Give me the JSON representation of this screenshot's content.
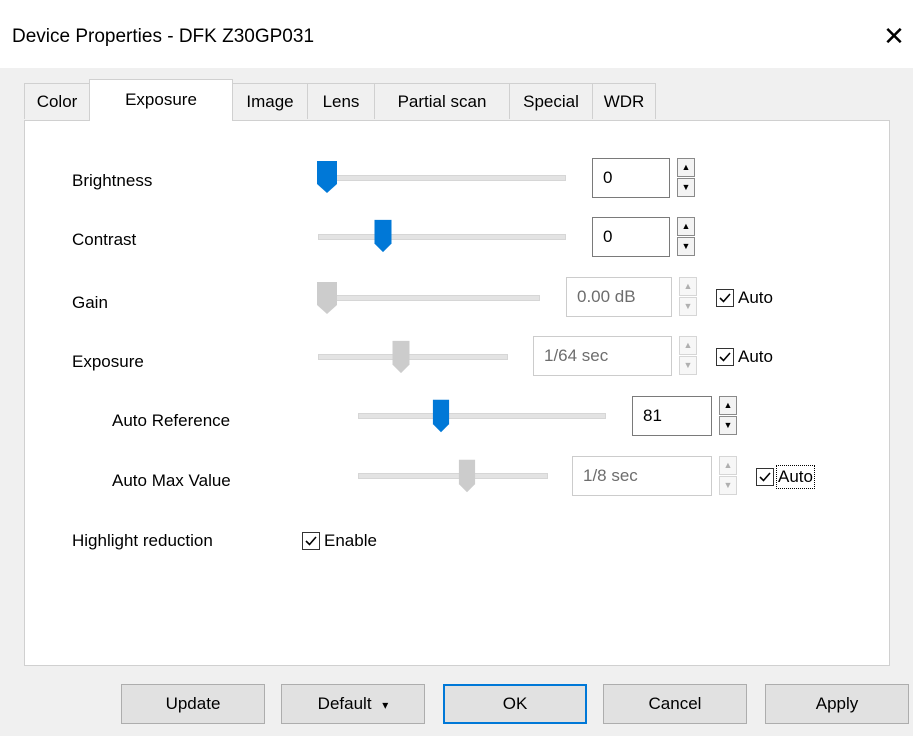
{
  "window": {
    "title": "Device Properties - DFK Z30GP031",
    "close_icon": "close-icon"
  },
  "tabs": [
    {
      "label": "Color",
      "active": false
    },
    {
      "label": "Exposure",
      "active": true
    },
    {
      "label": "Image",
      "active": false
    },
    {
      "label": "Lens",
      "active": false
    },
    {
      "label": "Partial scan",
      "active": false
    },
    {
      "label": "Special",
      "active": false
    },
    {
      "label": "WDR",
      "active": false
    }
  ],
  "controls": {
    "brightness": {
      "label": "Brightness",
      "value": "0",
      "slider_position": 0.0,
      "enabled": true
    },
    "contrast": {
      "label": "Contrast",
      "value": "0",
      "slider_position": 0.25,
      "enabled": true
    },
    "gain": {
      "label": "Gain",
      "value": "0.00 dB",
      "slider_position": 0.0,
      "enabled": false,
      "auto_label": "Auto",
      "auto_checked": true
    },
    "exposure": {
      "label": "Exposure",
      "value": "1/64 sec",
      "slider_position": 0.45,
      "enabled": false,
      "auto_label": "Auto",
      "auto_checked": true
    },
    "auto_reference": {
      "label": "Auto Reference",
      "value": "81",
      "slider_position": 0.3,
      "enabled": true
    },
    "auto_max_value": {
      "label": "Auto Max Value",
      "value": "1/8 sec",
      "slider_position": 0.57,
      "enabled": false,
      "auto_label": "Auto",
      "auto_checked": true
    },
    "highlight_reduction": {
      "label": "Highlight reduction",
      "enable_label": "Enable",
      "enable_checked": true
    }
  },
  "buttons": {
    "update": "Update",
    "default": "Default",
    "default_arrow": "▾",
    "ok": "OK",
    "cancel": "Cancel",
    "apply": "Apply"
  },
  "colors": {
    "accent": "#0078d7",
    "disabled_thumb": "#cccccc"
  }
}
